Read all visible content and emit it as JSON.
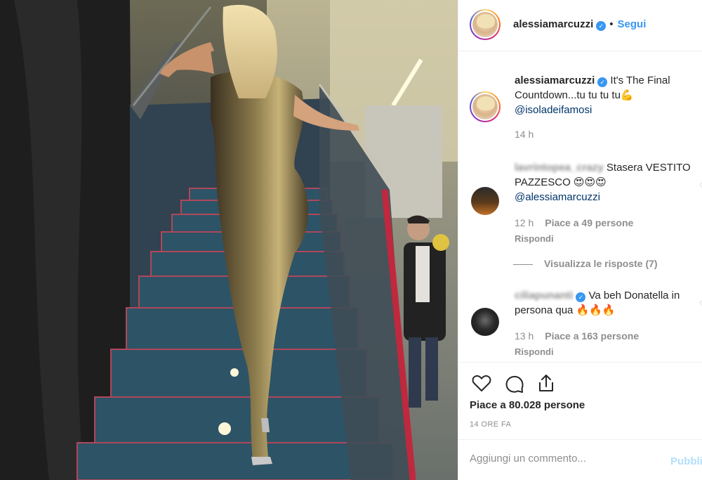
{
  "post": {
    "username": "alessiamarcuzzi",
    "verified_icon": "verified-badge-icon",
    "separator": "•",
    "follow_label": "Segui",
    "photo_alt": "photo"
  },
  "caption": {
    "username": "alessiamarcuzzi",
    "text": "It's The Final Countdown...tu tu tu tu💪",
    "mention": "@isoladeifamosi",
    "time": "14 h"
  },
  "comments": [
    {
      "username": "lavrintopea_crazy",
      "text": "Stasera VESTITO PAZZESCO 😍😍😍",
      "mention": "@alessiamarcuzzi",
      "time": "12 h",
      "likes": "Piace a 49 persone",
      "reply": "Rispondi",
      "view_replies": "Visualizza le risposte (7)"
    },
    {
      "username": "ciliapunanti",
      "text": "Va beh Donatella in persona qua 🔥🔥🔥",
      "time": "13 h",
      "likes": "Piace a 163 persone",
      "reply": "Rispondi"
    }
  ],
  "actions": {
    "like_icon": "heart-icon",
    "comment_icon": "comment-icon",
    "share_icon": "share-icon",
    "likes_text": "Piace a 80.028 persone",
    "timestamp": "14 ORE FA"
  },
  "add_comment": {
    "placeholder": "Aggiungi un commento...",
    "publish_label": "Pubblica"
  },
  "colors": {
    "accent": "#3897f0",
    "muted": "#8e8e8e",
    "text": "#262626",
    "publish_disabled": "#b2dffc",
    "border": "#efefef"
  }
}
